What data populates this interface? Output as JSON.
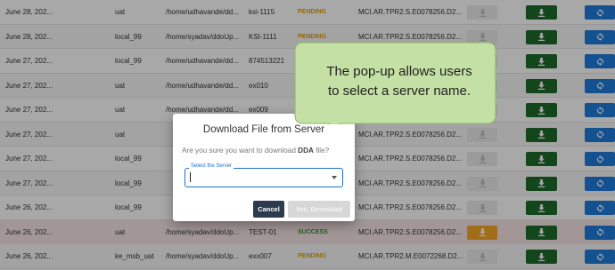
{
  "table": {
    "rows": [
      {
        "date": "June 28, 202...",
        "server": "uat",
        "path": "/home/udhavande/dd...",
        "tag": "ksi-1115",
        "status": "PENDING",
        "status_type": "pending",
        "file": "MCI.AR.TPR2.S.E0078256.D2...",
        "download_style": "grey",
        "bg": "white"
      },
      {
        "date": "June 28, 202...",
        "server": "local_99",
        "path": "/home/syadav/ddoUp...",
        "tag": "KSI-1111",
        "status": "PENDING",
        "status_type": "pending",
        "file": "MCI.AR.TPR2.S.E0078256.D2...",
        "download_style": "grey",
        "bg": "alt"
      },
      {
        "date": "June 27, 202...",
        "server": "local_99",
        "path": "/home/udhavande/dd...",
        "tag": "874513221",
        "status": "",
        "status_type": "",
        "file": "",
        "download_style": "grey",
        "bg": "white"
      },
      {
        "date": "June 27, 202...",
        "server": "uat",
        "path": "/home/udhavande/dd...",
        "tag": "ex010",
        "status": "",
        "status_type": "",
        "file": "",
        "download_style": "grey",
        "bg": "alt"
      },
      {
        "date": "June 27, 202...",
        "server": "uat",
        "path": "/home/udhavande/dd...",
        "tag": "ex009",
        "status": "",
        "status_type": "",
        "file": "",
        "download_style": "grey",
        "bg": "white"
      },
      {
        "date": "June 27, 202...",
        "server": "uat",
        "path": "",
        "tag": "",
        "status": "",
        "status_type": "",
        "file": "MCI.AR.TPR2.S.E0078256.D2...",
        "download_style": "grey",
        "bg": "alt"
      },
      {
        "date": "June 27, 202...",
        "server": "local_99",
        "path": "",
        "tag": "",
        "status": "",
        "status_type": "",
        "file": "MCI.AR.TPR2.S.E0078256.D2...",
        "download_style": "grey",
        "bg": "white"
      },
      {
        "date": "June 27, 202...",
        "server": "local_99",
        "path": "",
        "tag": "",
        "status": "",
        "status_type": "",
        "file": "MCI.AR.TPR2.S.E0078256.D2...",
        "download_style": "grey",
        "bg": "alt"
      },
      {
        "date": "June 26, 202...",
        "server": "local_99",
        "path": "",
        "tag": "",
        "status": "",
        "status_type": "",
        "file": "MCI.AR.TPR2.S.E0078256.D2...",
        "download_style": "grey",
        "bg": "white"
      },
      {
        "date": "June 26, 202...",
        "server": "uat",
        "path": "/home/syadav/ddoUp...",
        "tag": "TEST-01",
        "status": "SUCCESS",
        "status_type": "success",
        "file": "MCI.AR.TPR2.S.E0078256.D2...",
        "download_style": "orange",
        "bg": "hl"
      },
      {
        "date": "June 26, 202...",
        "server": "ke_msb_uat",
        "path": "/home/syadav/ddoUp...",
        "tag": "exx007",
        "status": "PENDING",
        "status_type": "pending",
        "file": "MCI.AR.TPR2.M.E0072268.D2...",
        "download_style": "grey",
        "bg": "alt"
      }
    ]
  },
  "dialog": {
    "title": "Download File from Server",
    "message_prefix": "Are you sure you want to download ",
    "message_bold": "DDA",
    "message_suffix": " file?",
    "select_label": "Select the Server",
    "select_value": "",
    "cancel_label": "Cancel",
    "confirm_label": "Yes, Download"
  },
  "callout": {
    "line1": "The pop-up allows users",
    "line2": "to select a server name."
  },
  "colors": {
    "green_button": "#1e6b2a",
    "blue_button": "#1f7bdc",
    "orange_button": "#f4a623",
    "pending": "#e0a000",
    "success": "#2e9a2e",
    "focus": "#1f6fd1",
    "callout_fill": "#c4e0a4"
  }
}
